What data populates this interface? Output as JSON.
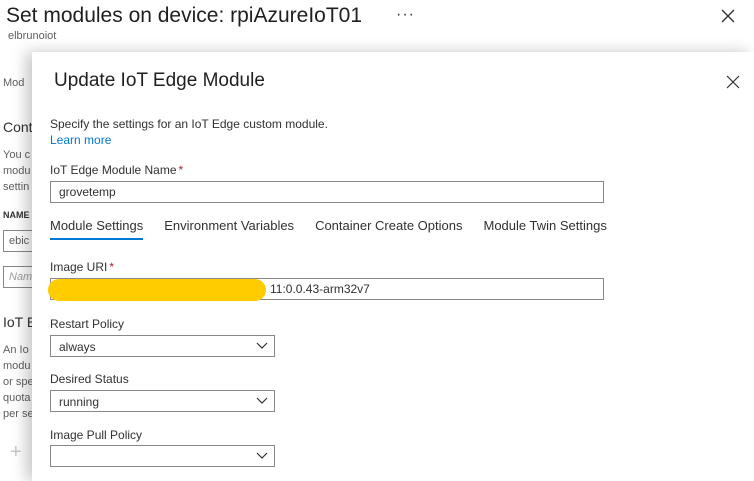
{
  "background": {
    "title": "Set modules on device: rpiAzureIoT01",
    "ellipsis": "···",
    "subtitle": "elbrunoiot",
    "fragments": {
      "mod_tab": "Mod",
      "cont_heading": "Cont",
      "you_line1": "You c",
      "you_line2": "modu",
      "you_line3": "settin",
      "name_label": "NAME",
      "ebi_input": "ebic",
      "name_placeholder": "Nam",
      "iot_heading": "IoT E",
      "an_line1": "An Io",
      "an_line2": "modu",
      "an_line3": "or spe",
      "an_line4": "quota",
      "an_line5": "per se"
    }
  },
  "flyout": {
    "title": "Update IoT Edge Module",
    "description": "Specify the settings for an IoT Edge custom module.",
    "learn_more": "Learn more",
    "module_name": {
      "label": "IoT Edge Module Name",
      "required_mark": "*",
      "value": "grovetemp"
    },
    "tabs": [
      {
        "label": "Module Settings",
        "active": true
      },
      {
        "label": "Environment Variables",
        "active": false
      },
      {
        "label": "Container Create Options",
        "active": false
      },
      {
        "label": "Module Twin Settings",
        "active": false
      }
    ],
    "image_uri": {
      "label": "Image URI",
      "required_mark": "*",
      "visible_value": "11:0.0.43-arm32v7"
    },
    "restart_policy": {
      "label": "Restart Policy",
      "value": "always"
    },
    "desired_status": {
      "label": "Desired Status",
      "value": "running"
    },
    "image_pull_policy": {
      "label": "Image Pull Policy",
      "value": ""
    }
  },
  "colors": {
    "accent": "#0078d4",
    "required": "#a4262c",
    "redaction": "#ffcc00"
  }
}
